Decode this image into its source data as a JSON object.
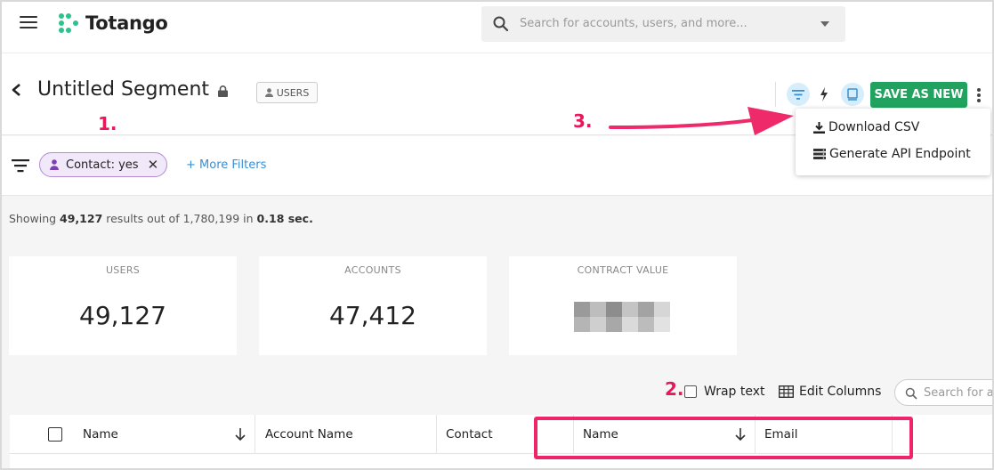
{
  "app": {
    "logo_text": "Totango",
    "search_placeholder": "Search for accounts, users, and more..."
  },
  "segment": {
    "title": "Untitled Segment",
    "type_tag": "USERS",
    "save_label": "SAVE AS NEW"
  },
  "menu": {
    "items": [
      {
        "label": "Download CSV",
        "icon": "download-icon"
      },
      {
        "label": "Generate API Endpoint",
        "icon": "api-icon"
      }
    ]
  },
  "annotations": {
    "step1": "1.",
    "step2": "2.",
    "step3": "3."
  },
  "filters": {
    "chip_label": "Contact: yes",
    "more_label": "+ More Filters"
  },
  "results": {
    "prefix": "Showing ",
    "count": "49,127",
    "mid": " results out of ",
    "total": "1,780,199",
    "mid2": " in ",
    "time": "0.18 sec."
  },
  "stats": [
    {
      "label": "USERS",
      "value": "49,127"
    },
    {
      "label": "ACCOUNTS",
      "value": "47,412"
    },
    {
      "label": "CONTRACT VALUE",
      "value": ""
    }
  ],
  "table_controls": {
    "wrap_label": "Wrap text",
    "edit_columns_label": "Edit Columns",
    "search_placeholder": "Search for a"
  },
  "table": {
    "columns": [
      "Name",
      "Account Name",
      "Contact",
      "Name",
      "Email"
    ]
  },
  "colors": {
    "brand_green": "#21a35f",
    "logo_green": "#2cc28d",
    "annotation_pink": "#e8185a",
    "chip_purple": "#b38bd6"
  }
}
